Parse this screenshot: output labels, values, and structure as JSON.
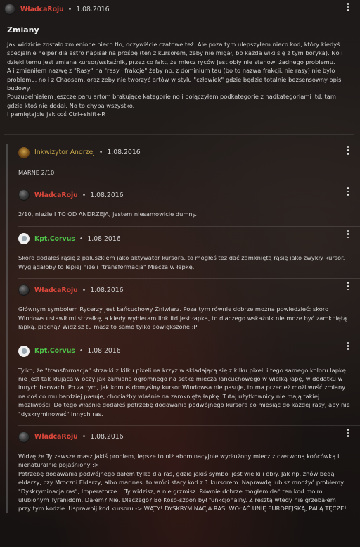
{
  "main_post": {
    "author": "WładcaRoju",
    "date": "1.08.2016",
    "title": "Zmiany",
    "lines": [
      "Jak widzicie zostało zmienione nieco tło, oczywiście czatowe też. Ale poza tym ulepszyłem nieco kod, który kiedyś specjalnie helper dla astro napisał na prośbę (ten z kursorem, żeby nie migał, bo każda wiki się z tym boryka). No i dzięki temu jest zmiana kursor/wskaźnik, przez co fakt, że miecz ryców jest obły nie stanowi żadnego problemu.",
      "A i zmieniłem nazwę z \"Rasy\" na \"rasy i frakcje\" żeby np. z dominium tau (bo to nazwa frakcji, nie rasy) nie było problemu, no i z Chaosem, oraz żeby nie tworzyć artów w stylu \"człowiek\" gdzie będzie totalnie bezsensowny opis budowy.",
      "Pouzupełniałem jeszcze paru artom brakujące kategorie no i połączyłem podkategorie z nadkategoriami itd, tam gdzie ktoś nie dodał. No to chyba wszystko.",
      "I pamiętajcie jak coś Ctrl+shift+R"
    ]
  },
  "replies": [
    {
      "author": "Inkwizytor Andrzej",
      "date": "1.08.2016",
      "avatar": "inkwizytor",
      "color": "gold",
      "lines": [
        "MARNE 2/10"
      ]
    },
    {
      "author": "WładcaRoju",
      "date": "1.08.2016",
      "avatar": "wladca",
      "color": "red",
      "lines": [
        "2/10, nieźle I TO OD ANDRZEJA, jestem niesamowicie dumny."
      ]
    },
    {
      "author": "Kpt.Corvus",
      "date": "1.08.2016",
      "avatar": "kpt",
      "color": "green",
      "lines": [
        "Skoro dodałeś rąsię z paluszkiem jako aktywator kursora, to mogłeś też dać zamkniętą rąsię jako zwykły kursor. Wyglądałoby to lepiej niżeli \"transformacja\" Miecza w łapkę."
      ]
    },
    {
      "author": "WładcaRoju",
      "date": "1.08.2016",
      "avatar": "wladca",
      "color": "red",
      "lines": [
        "Głównym symbolem Rycerzy jest Łańcuchowy Żniwiarz. Poza tym równie dobrze można powiedzieć: skoro Windows ustawił mi strzałkę, a kiedy wybieram link itd jest łapka, to dlaczego wskaźnik nie może być zamkniętą łapką, piąchą? Widzisz tu masz to samo tylko powiększone :P"
      ]
    },
    {
      "author": "Kpt.Corvus",
      "date": "1.08.2016",
      "avatar": "kpt",
      "color": "green",
      "lines": [
        "Tylko, że \"transformacja\" strzałki z kilku pixeli na krzyż w składającą się z kilku pixeli i tego samego koloru łapkę nie jest tak kłująca w oczy jak zamiana ogromnego na setkę miecza łańcuchowego w wielką łapę, w dodatku w innych barwach. Po za tym, jak komuś domyślny kursor Windowsa nie pasuje, to ma przecież możliwość zmiany na coś co mu bardziej pasuje, chociażby właśnie na zamkniętą łapkę. Tutaj użytkownicy nie mają takiej możliwości. Do tego właśnie dodałeś potrzebę dodawania podwójnego kursora co miesiąc do każdej rasy, aby nie \"dyskryminować\" innych ras."
      ]
    },
    {
      "author": "WładcaRoju",
      "date": "1.08.2016",
      "avatar": "wladca",
      "color": "red",
      "lines": [
        "Widzę że Ty zawsze masz jakiś problem, lepsze to niż abominacyjnie wydłużony miecz z czerwoną końcówką i nienaturalnie pojaśniony ;>",
        "Potrzebę dodawania podwójnego dałem tylko dla ras, gdzie jakiś symbol jest wielki i obły. Jak np. znów będą eldarzy, czy Mroczni Eldarzy, albo marines, to wróci stary kod z 1 kursorem. Naprawdę lubisz mnożyć problemy. \"Dyskryminacja ras\", Imperatorze... Ty widzisz, a nie grzmisz. Równie dobrze mogłem dać ten kod moim ulubionym Tyranidom. Dałem? Nie. Dlaczego? Bo Koso-szpon był funkcjonalny. Z resztą wtedy nie grzebałem przy tym kodzie. Usprawnij kod kursoru -> WĄTY! DYSKRYMINACJA RASI WOŁAĆ UNIĘ EUROPEJSKĄ, PALĄ TĘCZE!"
      ]
    }
  ]
}
